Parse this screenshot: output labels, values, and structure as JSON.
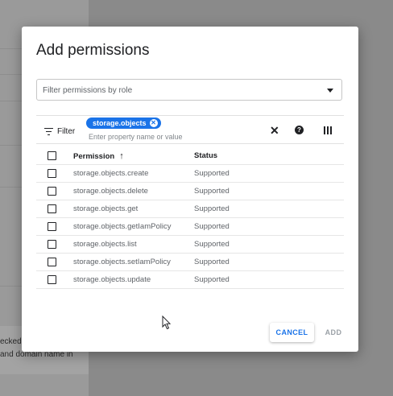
{
  "background": {
    "text_line1": "ecked",
    "text_line2": "and domain name in"
  },
  "dialog": {
    "title": "Add permissions",
    "role_filter": {
      "placeholder": "Filter permissions by role"
    },
    "filter": {
      "label": "Filter",
      "chip": "storage.objects",
      "input_placeholder": "Enter property name or value"
    },
    "table": {
      "columns": [
        "Permission",
        "Status"
      ],
      "rows": [
        {
          "permission": "storage.objects.create",
          "status": "Supported"
        },
        {
          "permission": "storage.objects.delete",
          "status": "Supported"
        },
        {
          "permission": "storage.objects.get",
          "status": "Supported"
        },
        {
          "permission": "storage.objects.getIamPolicy",
          "status": "Supported"
        },
        {
          "permission": "storage.objects.list",
          "status": "Supported"
        },
        {
          "permission": "storage.objects.setIamPolicy",
          "status": "Supported"
        },
        {
          "permission": "storage.objects.update",
          "status": "Supported"
        }
      ]
    },
    "buttons": {
      "cancel": "CANCEL",
      "add": "ADD"
    }
  },
  "colors": {
    "accent": "#1a73e8",
    "overlay": "#8a8a8a"
  },
  "icons": [
    "filter-icon",
    "chip-remove-icon",
    "close-icon",
    "help-icon",
    "columns-icon",
    "sort-arrow-up-icon",
    "mouse-cursor-icon"
  ]
}
